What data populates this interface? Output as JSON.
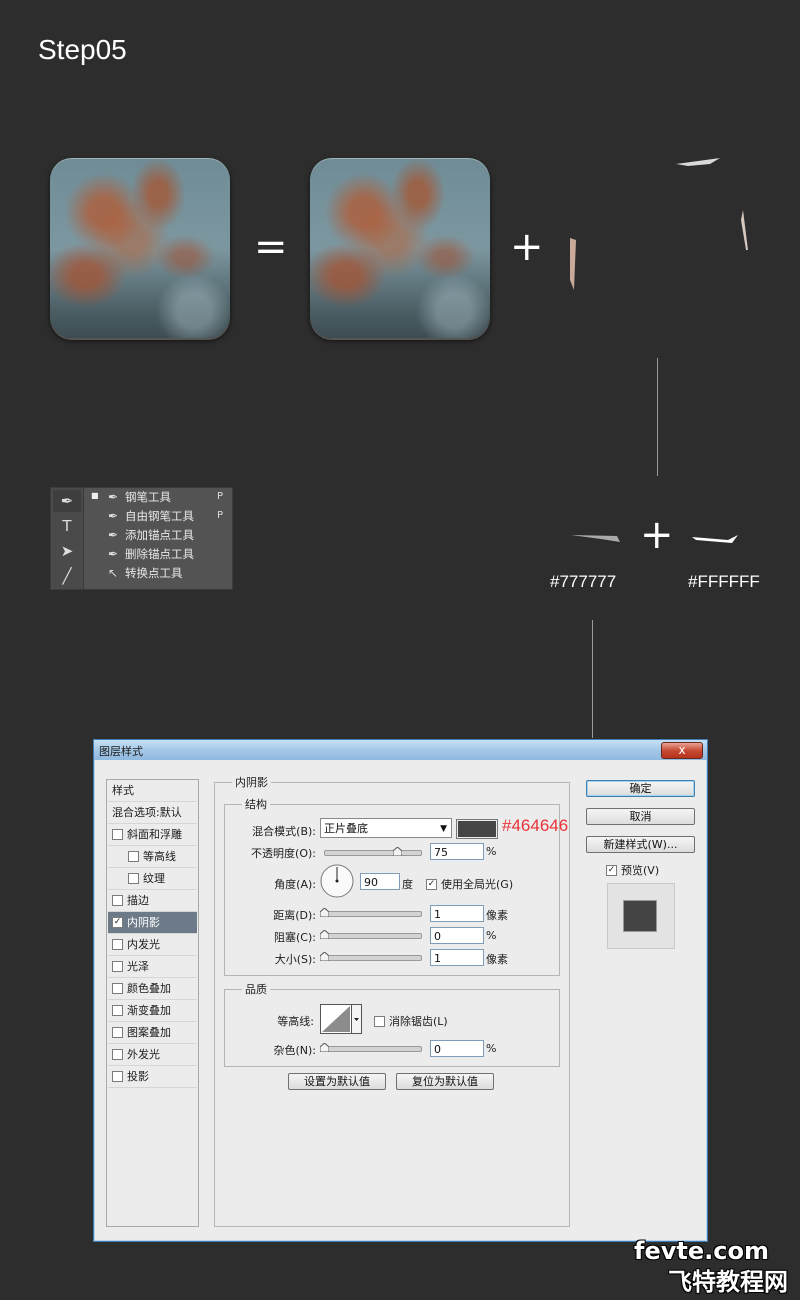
{
  "step_title": "Step05",
  "equation": {
    "equals": "=",
    "plus": "+"
  },
  "tool_panel": {
    "items": [
      {
        "label": "钢笔工具",
        "shortcut": "P"
      },
      {
        "label": "自由钢笔工具",
        "shortcut": "P"
      },
      {
        "label": "添加锚点工具",
        "shortcut": ""
      },
      {
        "label": "删除锚点工具",
        "shortcut": ""
      },
      {
        "label": "转换点工具",
        "shortcut": ""
      }
    ],
    "tool_buttons": [
      "pen-tool-icon",
      "type-tool-icon",
      "path-select-icon",
      "line-tool-icon"
    ]
  },
  "shard_colors": {
    "plus": "+",
    "left_hex": "#777777",
    "right_hex": "#FFFFFF"
  },
  "dialog": {
    "title": "图层样式",
    "close": "x",
    "style_list": [
      {
        "label": "样式",
        "checkbox": false,
        "checked": false,
        "indent": false,
        "selected": false
      },
      {
        "label": "混合选项:默认",
        "checkbox": false,
        "checked": false,
        "indent": false,
        "selected": false
      },
      {
        "label": "斜面和浮雕",
        "checkbox": true,
        "checked": false,
        "indent": false,
        "selected": false
      },
      {
        "label": "等高线",
        "checkbox": true,
        "checked": false,
        "indent": true,
        "selected": false
      },
      {
        "label": "纹理",
        "checkbox": true,
        "checked": false,
        "indent": true,
        "selected": false
      },
      {
        "label": "描边",
        "checkbox": true,
        "checked": false,
        "indent": false,
        "selected": false
      },
      {
        "label": "内阴影",
        "checkbox": true,
        "checked": true,
        "indent": false,
        "selected": true
      },
      {
        "label": "内发光",
        "checkbox": true,
        "checked": false,
        "indent": false,
        "selected": false
      },
      {
        "label": "光泽",
        "checkbox": true,
        "checked": false,
        "indent": false,
        "selected": false
      },
      {
        "label": "颜色叠加",
        "checkbox": true,
        "checked": false,
        "indent": false,
        "selected": false
      },
      {
        "label": "渐变叠加",
        "checkbox": true,
        "checked": false,
        "indent": false,
        "selected": false
      },
      {
        "label": "图案叠加",
        "checkbox": true,
        "checked": false,
        "indent": false,
        "selected": false
      },
      {
        "label": "外发光",
        "checkbox": true,
        "checked": false,
        "indent": false,
        "selected": false
      },
      {
        "label": "投影",
        "checkbox": true,
        "checked": false,
        "indent": false,
        "selected": false
      }
    ],
    "section_title": "内阴影",
    "structure": {
      "title": "结构",
      "blend_mode_label": "混合模式(B):",
      "blend_mode_value": "正片叠底",
      "color_hex": "#464646",
      "opacity_label": "不透明度(O):",
      "opacity_value": "75",
      "opacity_unit": "%",
      "opacity_level": 0.75,
      "angle_label": "角度(A):",
      "angle_value": "90",
      "angle_unit": "度",
      "global_light_label": "使用全局光(G)",
      "global_light_checked": true,
      "distance_label": "距离(D):",
      "distance_value": "1",
      "distance_unit": "像素",
      "choke_label": "阻塞(C):",
      "choke_value": "0",
      "choke_unit": "%",
      "size_label": "大小(S):",
      "size_value": "1",
      "size_unit": "像素"
    },
    "quality": {
      "title": "品质",
      "contour_label": "等高线:",
      "antialias_label": "消除锯齿(L)",
      "antialias_checked": false,
      "noise_label": "杂色(N):",
      "noise_value": "0",
      "noise_unit": "%"
    },
    "buttons": {
      "make_default": "设置为默认值",
      "reset_default": "复位为默认值",
      "ok": "确定",
      "cancel": "取消",
      "new_style": "新建样式(W)...",
      "preview_label": "预览(V)",
      "preview_checked": true
    }
  },
  "watermark": {
    "line1": "fevte.com",
    "line2": "飞特教程网"
  },
  "colors": {
    "background": "#2d2d2d",
    "accent_red": "#e8343a",
    "inner_shadow": "#464646"
  }
}
